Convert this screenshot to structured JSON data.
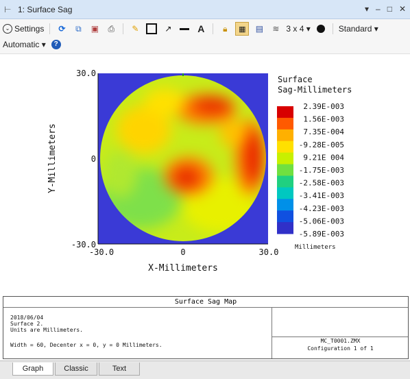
{
  "window": {
    "title": "1: Surface Sag",
    "controls": [
      "▾",
      "–",
      "□",
      "✕"
    ]
  },
  "toolbar": {
    "settings_label": "Settings",
    "grid_label": "3 x 4 ▾",
    "standard_label": "Standard ▾",
    "automatic_label": "Automatic ▾"
  },
  "chart_data": {
    "type": "heatmap",
    "xlabel": "X-Millimeters",
    "ylabel": "Y-Millimeters",
    "xlim": [
      -30.0,
      30.0
    ],
    "ylim": [
      -30.0,
      30.0
    ],
    "x_ticks": [
      "-30.0",
      "0",
      "30.0"
    ],
    "y_ticks": [
      "30.0",
      "0",
      "-30.0"
    ],
    "legend_title": [
      "Surface",
      "Sag-Millimeters"
    ],
    "legend_unit": "Millimeters",
    "legend_values": [
      "2.39E-003",
      "1.56E-003",
      "7.35E-004",
      "-9.28E-005",
      "9.21E 004",
      "-1.75E-003",
      "-2.58E-003",
      "-3.41E-003",
      "-4.23E-003",
      "-5.06E-003",
      "-5.89E-003"
    ],
    "background_color": "#3a3ad6",
    "colormap": [
      "#d80000",
      "#ff5a00",
      "#ffb000",
      "#ffe000",
      "#c8f000",
      "#70e040",
      "#20d080",
      "#00c8c0",
      "#0090e8",
      "#1050e0",
      "#3030c8"
    ]
  },
  "info": {
    "title": "Surface Sag Map",
    "date": "2018/06/04",
    "surface": "Surface 2.",
    "units": "Units are Millimeters.",
    "width": "Width = 60, Decenter x = 0, y = 0 Millimeters.",
    "file": "MC_T0001.ZMX",
    "config": "Configuration 1 of 1"
  },
  "tabs": [
    "Graph",
    "Classic",
    "Text"
  ]
}
